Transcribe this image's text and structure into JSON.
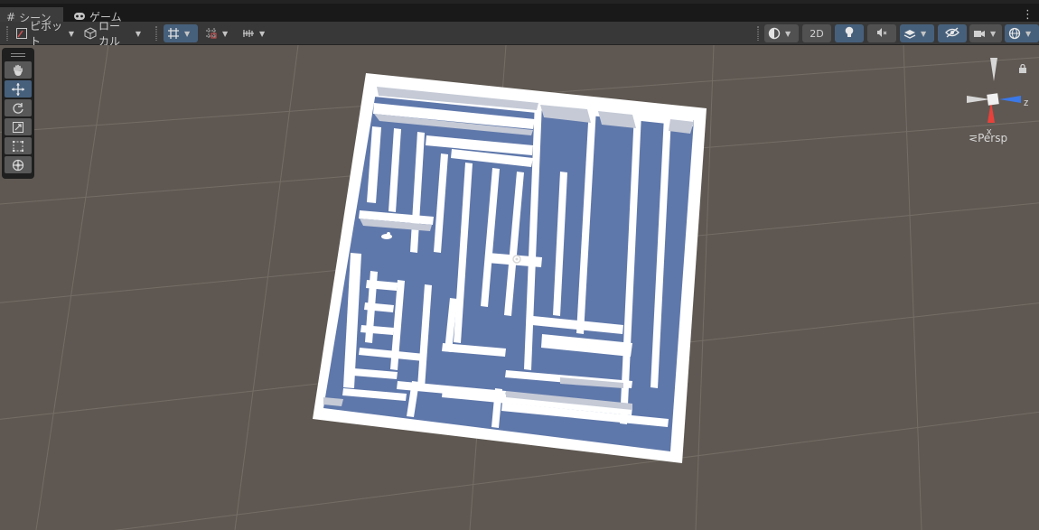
{
  "tabs": {
    "scene_label": "シーン",
    "game_label": "ゲーム"
  },
  "toolbar": {
    "pivot_label": "ピボット",
    "local_label": "ローカル",
    "mode_2d_label": "2D"
  },
  "gizmo": {
    "x_label": "x",
    "z_label": "z",
    "projection_label": "Persp"
  },
  "colors": {
    "scene_bg": "#5f5852",
    "grid_line": "#76706a",
    "maze_wall": "#ffffff",
    "maze_floor": "#5f78ab",
    "active_tool": "#46607c",
    "axis_x": "#e8413b",
    "axis_z": "#3b78e8"
  }
}
